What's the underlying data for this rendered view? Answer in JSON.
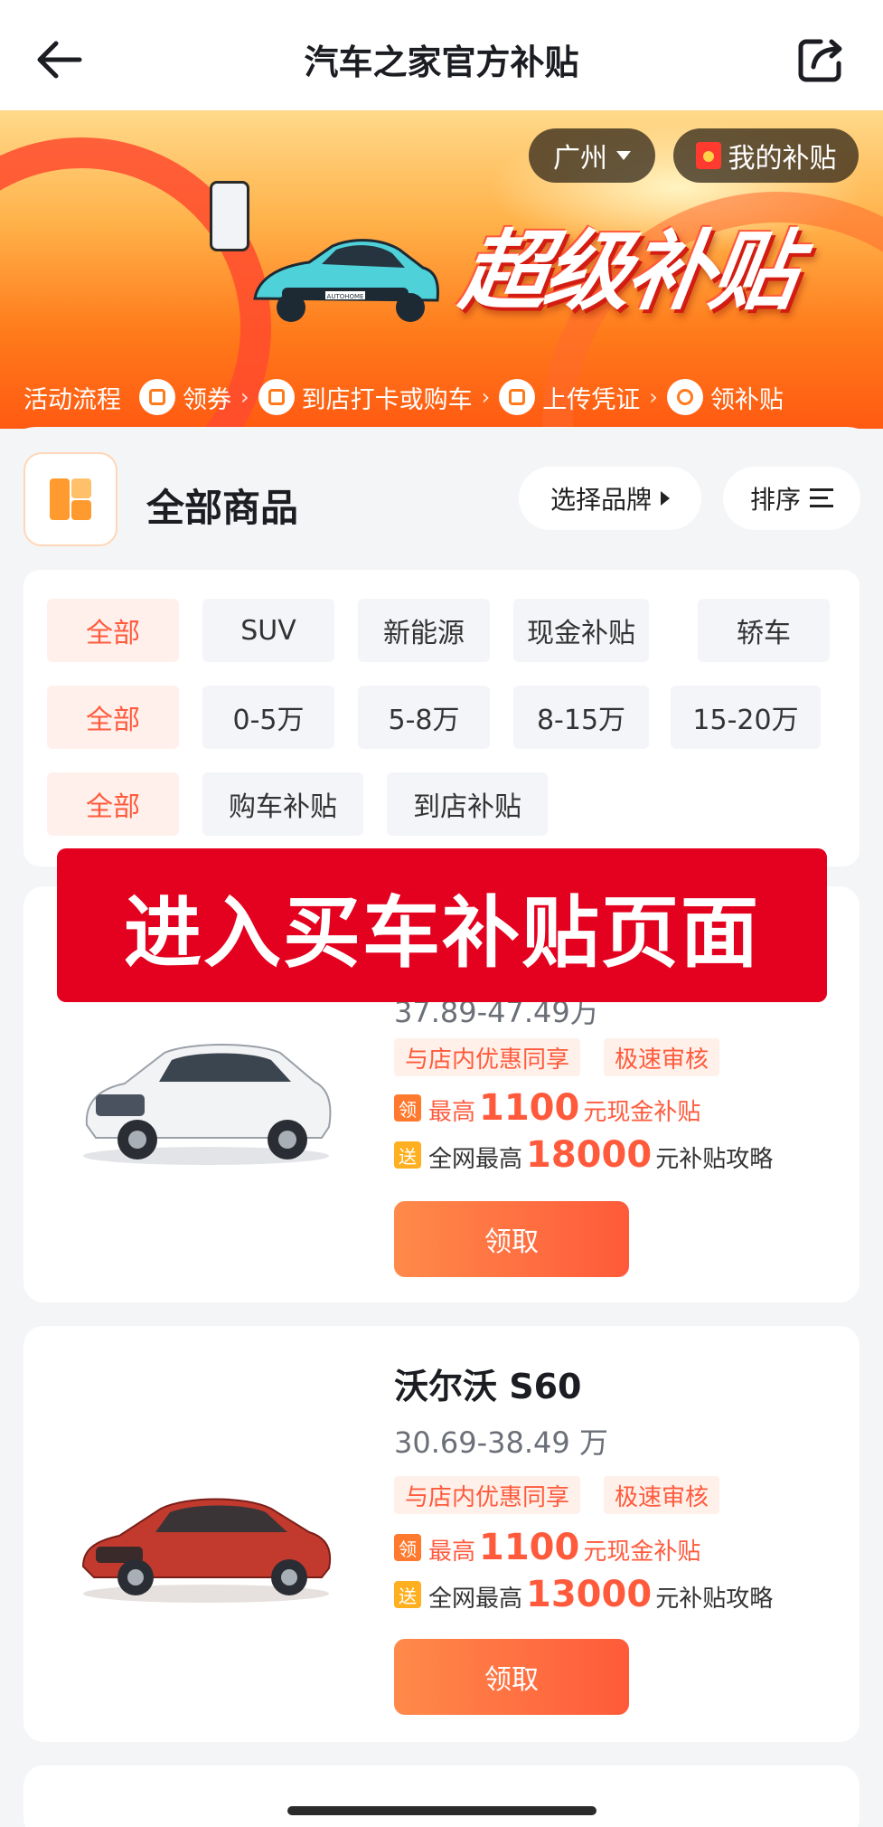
{
  "header": {
    "title": "汽车之家官方补贴"
  },
  "banner": {
    "city": "广州",
    "my_subsidy": "我的补贴",
    "promo": "超级补贴",
    "car_plate": "AUTOHOME",
    "flow": {
      "label": "活动流程",
      "steps": [
        "领券",
        "到店打卡或购车",
        "上传凭证",
        "领补贴"
      ]
    }
  },
  "section": {
    "title": "全部商品",
    "brand_button": "选择品牌",
    "sort_button": "排序"
  },
  "filters": {
    "row1": [
      "全部",
      "SUV",
      "新能源",
      "现金补贴",
      "轿车"
    ],
    "row2": [
      "全部",
      "0-5万",
      "5-8万",
      "8-15万",
      "15-20万"
    ],
    "row3": [
      "全部",
      "购车补贴",
      "到店补贴"
    ]
  },
  "overlay": {
    "text": "进入买车补贴页面"
  },
  "products": [
    {
      "price": "37.89-47.49万",
      "tags": [
        "与店内优惠同享",
        "极速审核"
      ],
      "coupon": {
        "badge": "领",
        "prefix": "最高",
        "amount": "1100",
        "suffix": "元现金补贴"
      },
      "gift": {
        "badge": "送",
        "prefix": "全网最高",
        "amount": "18000",
        "suffix": "元补贴攻略"
      },
      "claim": "领取",
      "car_color": "#f2f3f5"
    },
    {
      "name": "沃尔沃 S60",
      "price": "30.69-38.49 万",
      "tags": [
        "与店内优惠同享",
        "极速审核"
      ],
      "coupon": {
        "badge": "领",
        "prefix": "最高",
        "amount": "1100",
        "suffix": "元现金补贴"
      },
      "gift": {
        "badge": "送",
        "prefix": "全网最高",
        "amount": "13000",
        "suffix": "元补贴攻略"
      },
      "claim": "领取",
      "car_color": "#c23a2e"
    }
  ],
  "colors": {
    "accent": "#ff5a3c",
    "overlay_red": "#e4001f",
    "banner_orange": "#ff7a1a"
  },
  "icons": [
    "back-arrow-icon",
    "share-icon",
    "caret-down-icon",
    "red-packet-icon",
    "all-goods-icon",
    "triangle-right-icon",
    "sort-lines-icon"
  ]
}
